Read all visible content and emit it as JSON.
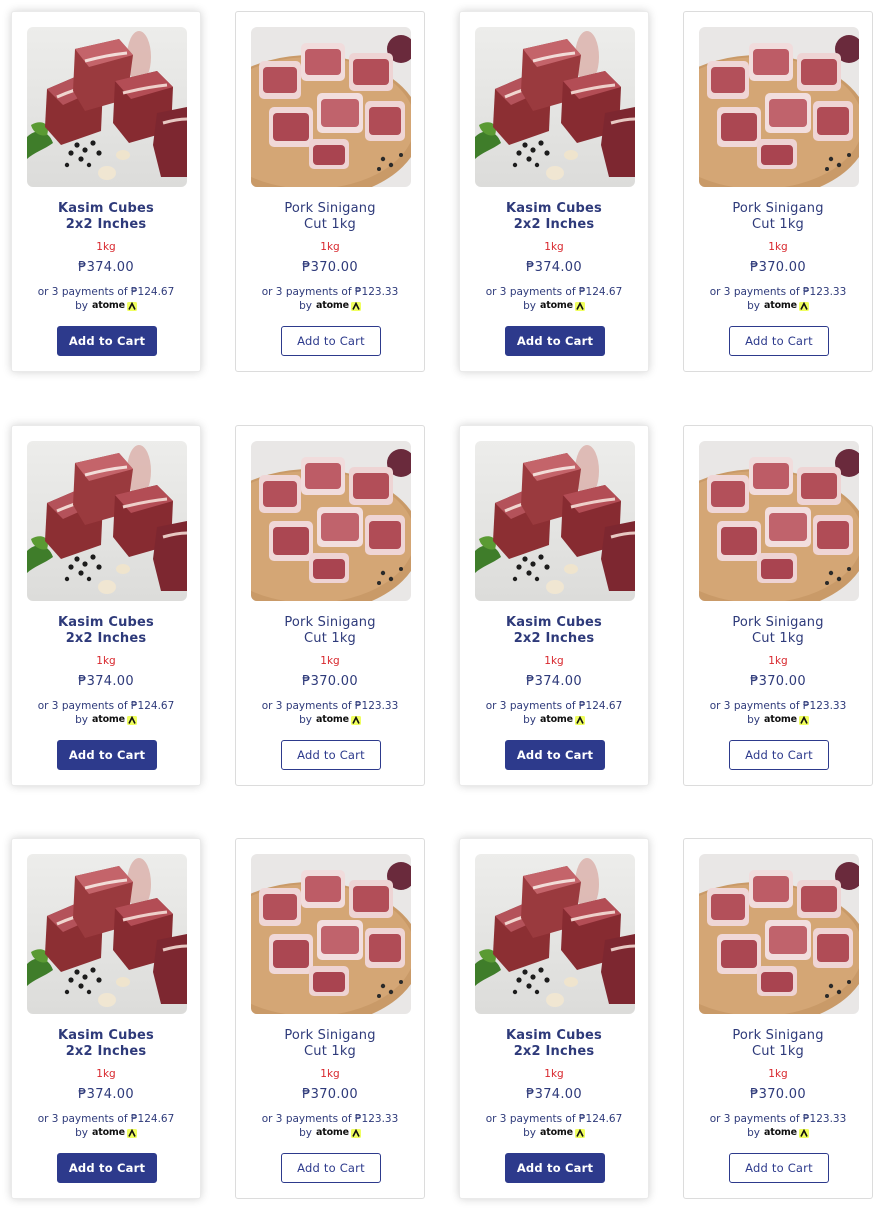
{
  "currency_symbol": "₱",
  "bnpl_provider": "atome",
  "colors": {
    "brand_navy": "#2d3a8c",
    "weight_red": "#d8272d",
    "atome_yellow": "#f0ff5f"
  },
  "products": [
    {
      "id": "kasim",
      "title_line1": "Kasim Cubes",
      "title_line2": "2x2 Inches",
      "weight": "1kg",
      "price": "₱374.00",
      "installment": "or 3 payments of ₱124.67",
      "by": "by",
      "cart_label": "Add to Cart",
      "image": "kasim-cubes-photo",
      "style": "featured"
    },
    {
      "id": "sinigang",
      "title_line1": "Pork Sinigang",
      "title_line2": "Cut 1kg",
      "weight": "1kg",
      "price": "₱370.00",
      "installment": "or 3 payments of ₱123.33",
      "by": "by",
      "cart_label": "Add to Cart",
      "image": "pork-sinigang-photo",
      "style": "outline"
    },
    {
      "id": "kasim",
      "title_line1": "Kasim Cubes",
      "title_line2": "2x2 Inches",
      "weight": "1kg",
      "price": "₱374.00",
      "installment": "or 3 payments of ₱124.67",
      "by": "by",
      "cart_label": "Add to Cart",
      "image": "kasim-cubes-photo",
      "style": "featured"
    },
    {
      "id": "sinigang",
      "title_line1": "Pork Sinigang",
      "title_line2": "Cut 1kg",
      "weight": "1kg",
      "price": "₱370.00",
      "installment": "or 3 payments of ₱123.33",
      "by": "by",
      "cart_label": "Add to Cart",
      "image": "pork-sinigang-photo",
      "style": "outline"
    },
    {
      "id": "kasim",
      "title_line1": "Kasim Cubes",
      "title_line2": "2x2 Inches",
      "weight": "1kg",
      "price": "₱374.00",
      "installment": "or 3 payments of ₱124.67",
      "by": "by",
      "cart_label": "Add to Cart",
      "image": "kasim-cubes-photo",
      "style": "featured"
    },
    {
      "id": "sinigang",
      "title_line1": "Pork Sinigang",
      "title_line2": "Cut 1kg",
      "weight": "1kg",
      "price": "₱370.00",
      "installment": "or 3 payments of ₱123.33",
      "by": "by",
      "cart_label": "Add to Cart",
      "image": "pork-sinigang-photo",
      "style": "outline"
    },
    {
      "id": "kasim",
      "title_line1": "Kasim Cubes",
      "title_line2": "2x2 Inches",
      "weight": "1kg",
      "price": "₱374.00",
      "installment": "or 3 payments of ₱124.67",
      "by": "by",
      "cart_label": "Add to Cart",
      "image": "kasim-cubes-photo",
      "style": "featured"
    },
    {
      "id": "sinigang",
      "title_line1": "Pork Sinigang",
      "title_line2": "Cut 1kg",
      "weight": "1kg",
      "price": "₱370.00",
      "installment": "or 3 payments of ₱123.33",
      "by": "by",
      "cart_label": "Add to Cart",
      "image": "pork-sinigang-photo",
      "style": "outline"
    },
    {
      "id": "kasim",
      "title_line1": "Kasim Cubes",
      "title_line2": "2x2 Inches",
      "weight": "1kg",
      "price": "₱374.00",
      "installment": "or 3 payments of ₱124.67",
      "by": "by",
      "cart_label": "Add to Cart",
      "image": "kasim-cubes-photo",
      "style": "featured"
    },
    {
      "id": "sinigang",
      "title_line1": "Pork Sinigang",
      "title_line2": "Cut 1kg",
      "weight": "1kg",
      "price": "₱370.00",
      "installment": "or 3 payments of ₱123.33",
      "by": "by",
      "cart_label": "Add to Cart",
      "image": "pork-sinigang-photo",
      "style": "outline"
    },
    {
      "id": "kasim",
      "title_line1": "Kasim Cubes",
      "title_line2": "2x2 Inches",
      "weight": "1kg",
      "price": "₱374.00",
      "installment": "or 3 payments of ₱124.67",
      "by": "by",
      "cart_label": "Add to Cart",
      "image": "kasim-cubes-photo",
      "style": "featured"
    },
    {
      "id": "sinigang",
      "title_line1": "Pork Sinigang",
      "title_line2": "Cut 1kg",
      "weight": "1kg",
      "price": "₱370.00",
      "installment": "or 3 payments of ₱123.33",
      "by": "by",
      "cart_label": "Add to Cart",
      "image": "pork-sinigang-photo",
      "style": "outline"
    }
  ]
}
